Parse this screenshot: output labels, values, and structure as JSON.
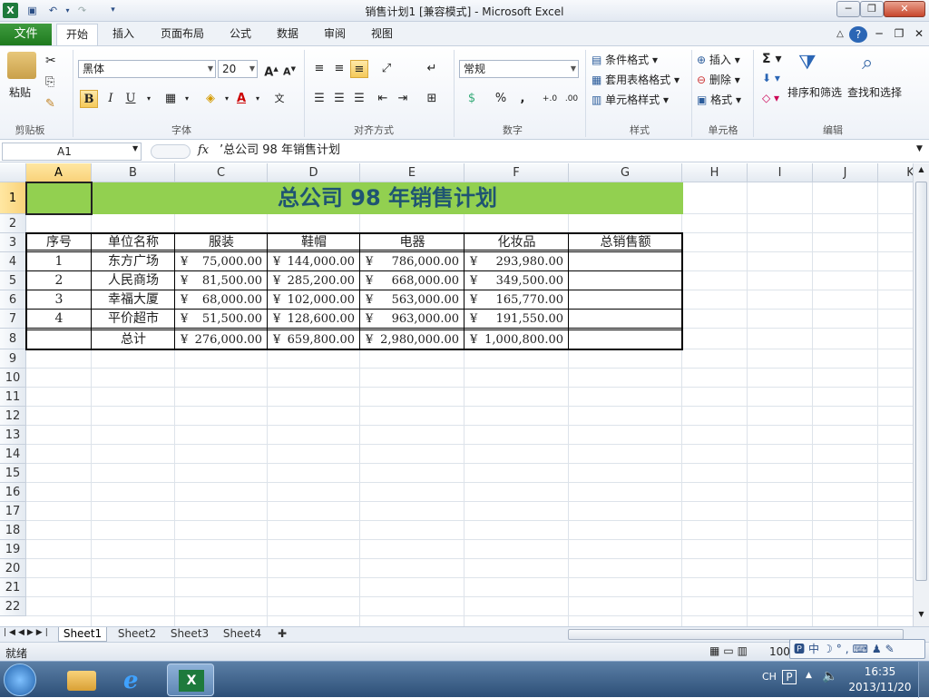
{
  "window": {
    "title": "销售计划1  [兼容模式]  -  Microsoft Excel"
  },
  "ribbon_tabs": [
    "文件",
    "开始",
    "插入",
    "页面布局",
    "公式",
    "数据",
    "审阅",
    "视图"
  ],
  "ribbon": {
    "clipboard": {
      "paste": "粘贴",
      "label": "剪贴板"
    },
    "font": {
      "name": "黑体",
      "size": "20",
      "label": "字体",
      "bold": "B",
      "italic": "I",
      "underline": "U"
    },
    "alignment": {
      "label": "对齐方式"
    },
    "number": {
      "format": "常规",
      "label": "数字"
    },
    "styles": {
      "conditional": "条件格式",
      "table_format": "套用表格格式",
      "cell_styles": "单元格样式",
      "label": "样式"
    },
    "cells": {
      "insert": "插入",
      "delete": "删除",
      "format": "格式",
      "label": "单元格"
    },
    "editing": {
      "sort_filter": "排序和筛选",
      "find_select": "查找和选择",
      "label": "编辑"
    }
  },
  "formula_bar": {
    "name_box": "A1",
    "fx": "fx",
    "content": "’总公司  98  年销售计划"
  },
  "columns": [
    "A",
    "B",
    "C",
    "D",
    "E",
    "F",
    "G",
    "H",
    "I",
    "J",
    "K"
  ],
  "rows": [
    "1",
    "2",
    "3",
    "4",
    "5",
    "6",
    "7",
    "8",
    "9",
    "10",
    "11",
    "12",
    "13",
    "14",
    "15",
    "16",
    "17",
    "18",
    "19",
    "20",
    "21",
    "22"
  ],
  "sheet": {
    "title": "总公司  98  年销售计划",
    "headers": [
      "序号",
      "单位名称",
      "服装",
      "鞋帽",
      "电器",
      "化妆品",
      "总销售额"
    ],
    "data": [
      [
        "1",
        "东方广场",
        "75,000.00",
        "144,000.00",
        "786,000.00",
        "293,980.00"
      ],
      [
        "2",
        "人民商场",
        "81,500.00",
        "285,200.00",
        "668,000.00",
        "349,500.00"
      ],
      [
        "3",
        "幸福大厦",
        "68,000.00",
        "102,000.00",
        "563,000.00",
        "165,770.00"
      ],
      [
        "4",
        "平价超市",
        "51,500.00",
        "128,600.00",
        "963,000.00",
        "191,550.00"
      ]
    ],
    "total_label": "总计",
    "totals": [
      "276,000.00",
      "659,800.00",
      "2,980,000.00",
      "1,000,800.00"
    ],
    "currency": "¥"
  },
  "sheet_tabs": [
    "Sheet1",
    "Sheet2",
    "Sheet3",
    "Sheet4"
  ],
  "status": {
    "ready": "就绪",
    "zoom": "100"
  },
  "taskbar": {
    "lang": "CH",
    "time": "16:35",
    "date": "2013/11/20"
  },
  "colors": {
    "title_fill": "#92d050",
    "title_text": "#1f5472",
    "file_tab": "#2a862a"
  }
}
